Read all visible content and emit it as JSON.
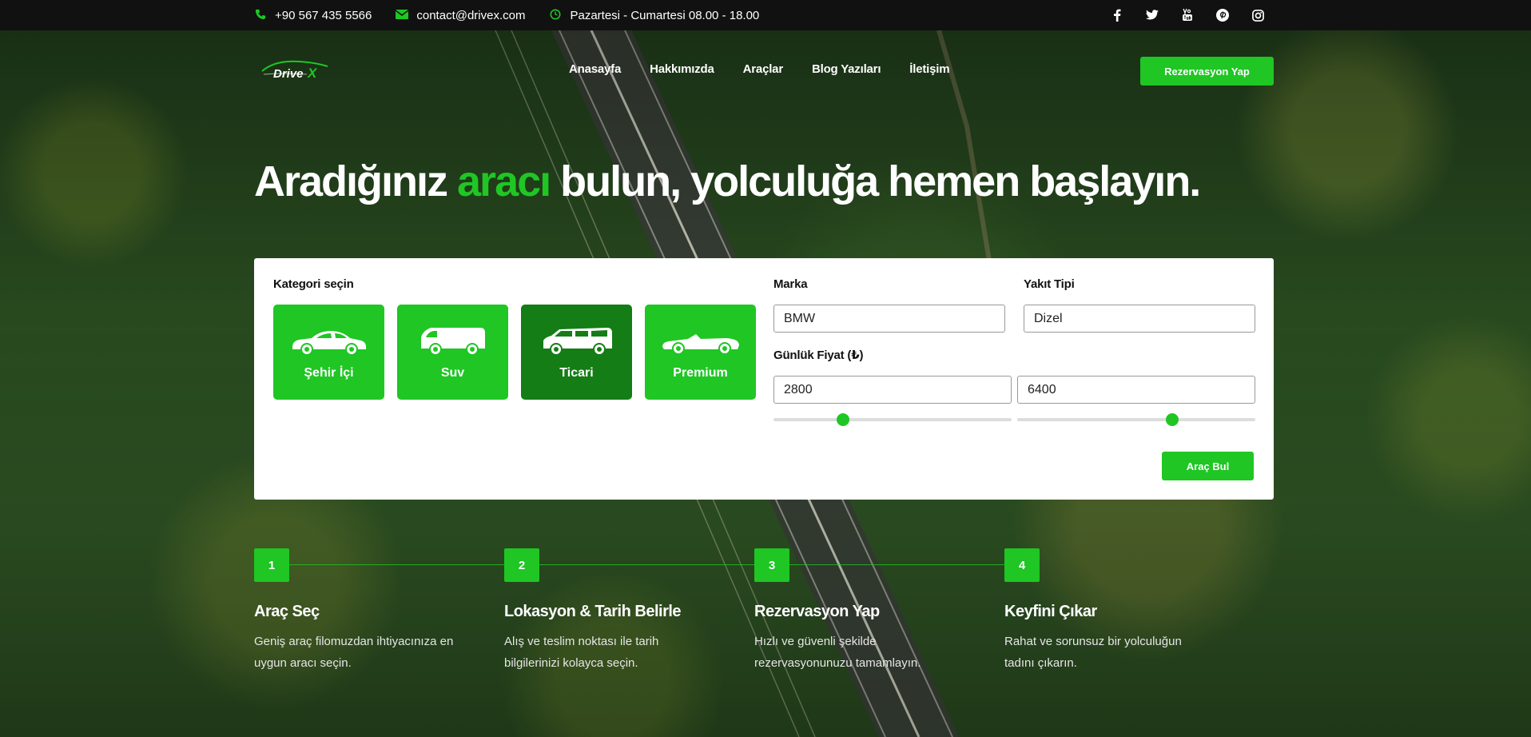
{
  "topbar": {
    "phone": "+90 567 435 5566",
    "email": "contact@drivex.com",
    "hours": "Pazartesi - Cumartesi 08.00 - 18.00",
    "social": [
      "facebook-icon",
      "twitter-icon",
      "youtube-icon",
      "pinterest-icon",
      "instagram-icon"
    ]
  },
  "brand": {
    "logo_text": "DriveX",
    "accent": "#1fc624",
    "accent_dark": "#147d16"
  },
  "nav": {
    "items": [
      "Anasayfa",
      "Hakkımızda",
      "Araçlar",
      "Blog Yazıları",
      "İletişim"
    ],
    "cta": "Rezervasyon Yap"
  },
  "hero": {
    "headline_before": "Aradığınız ",
    "headline_accent": "aracı",
    "headline_after": " bulun, yolculuğa hemen başlayın."
  },
  "search": {
    "category_label": "Kategori seçin",
    "categories": [
      {
        "label": "Şehir İçi",
        "icon": "sedan-icon",
        "active": false
      },
      {
        "label": "Suv",
        "icon": "van-icon",
        "active": false
      },
      {
        "label": "Ticari",
        "icon": "minivan-icon",
        "active": true
      },
      {
        "label": "Premium",
        "icon": "convertible-icon",
        "active": false
      }
    ],
    "brand_label": "Marka",
    "brand_value": "BMW",
    "fuel_label": "Yakıt Tipi",
    "fuel_value": "Dizel",
    "price_label": "Günlük Fiyat (₺)",
    "price_min": "2800",
    "price_max": "6400",
    "submit": "Araç Bul"
  },
  "steps": [
    {
      "num": "1",
      "title": "Araç Seç",
      "desc": "Geniş araç filomuzdan ihtiyacınıza en uygun aracı seçin."
    },
    {
      "num": "2",
      "title": "Lokasyon & Tarih Belirle",
      "desc": "Alış ve teslim noktası ile tarih bilgilerinizi kolayca seçin."
    },
    {
      "num": "3",
      "title": "Rezervasyon Yap",
      "desc": "Hızlı ve güvenli şekilde rezervasyonunuzu tamamlayın."
    },
    {
      "num": "4",
      "title": "Keyfini Çıkar",
      "desc": "Rahat ve sorunsuz bir yolculuğun tadını çıkarın."
    }
  ]
}
